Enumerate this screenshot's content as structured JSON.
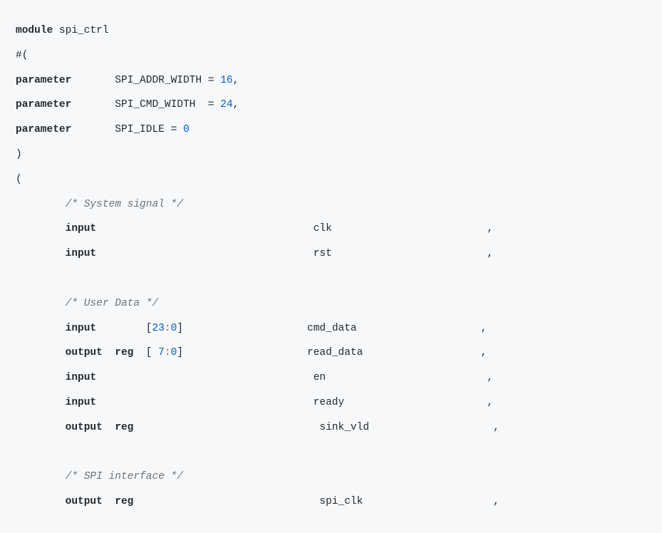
{
  "kw": {
    "module": "module",
    "parameter": "parameter",
    "input": "input",
    "output": "output",
    "reg": "reg"
  },
  "module_name": "spi_ctrl",
  "hash_open": "#(",
  "close_paren": ")",
  "open_paren": "(",
  "params": {
    "addr": {
      "name": "SPI_ADDR_WIDTH",
      "eq": " = ",
      "val": "16",
      "trail": ","
    },
    "cmd": {
      "name": "SPI_CMD_WIDTH",
      "eq": "  = ",
      "val": "24",
      "trail": ","
    },
    "idle": {
      "name": "SPI_IDLE",
      "eq": " = ",
      "val": "0",
      "trail": ""
    }
  },
  "comments": {
    "system": "/* System signal */",
    "user": "/* User Data */",
    "spi": "/* SPI interface */"
  },
  "ports": {
    "clk": {
      "name": "clk"
    },
    "rst": {
      "name": "rst"
    },
    "cmd_data": {
      "name": "cmd_data",
      "range_l": "23",
      "range_r": "0"
    },
    "read_data": {
      "name": "read_data",
      "range_l": " 7",
      "range_r": "0"
    },
    "en": {
      "name": "en"
    },
    "ready": {
      "name": "ready"
    },
    "sink_vld": {
      "name": "sink_vld"
    },
    "spi_clk": {
      "name": "spi_clk"
    }
  },
  "sym": {
    "comma": ",",
    "lbrack": "[",
    "rbrack": "]",
    "colon": ":"
  }
}
